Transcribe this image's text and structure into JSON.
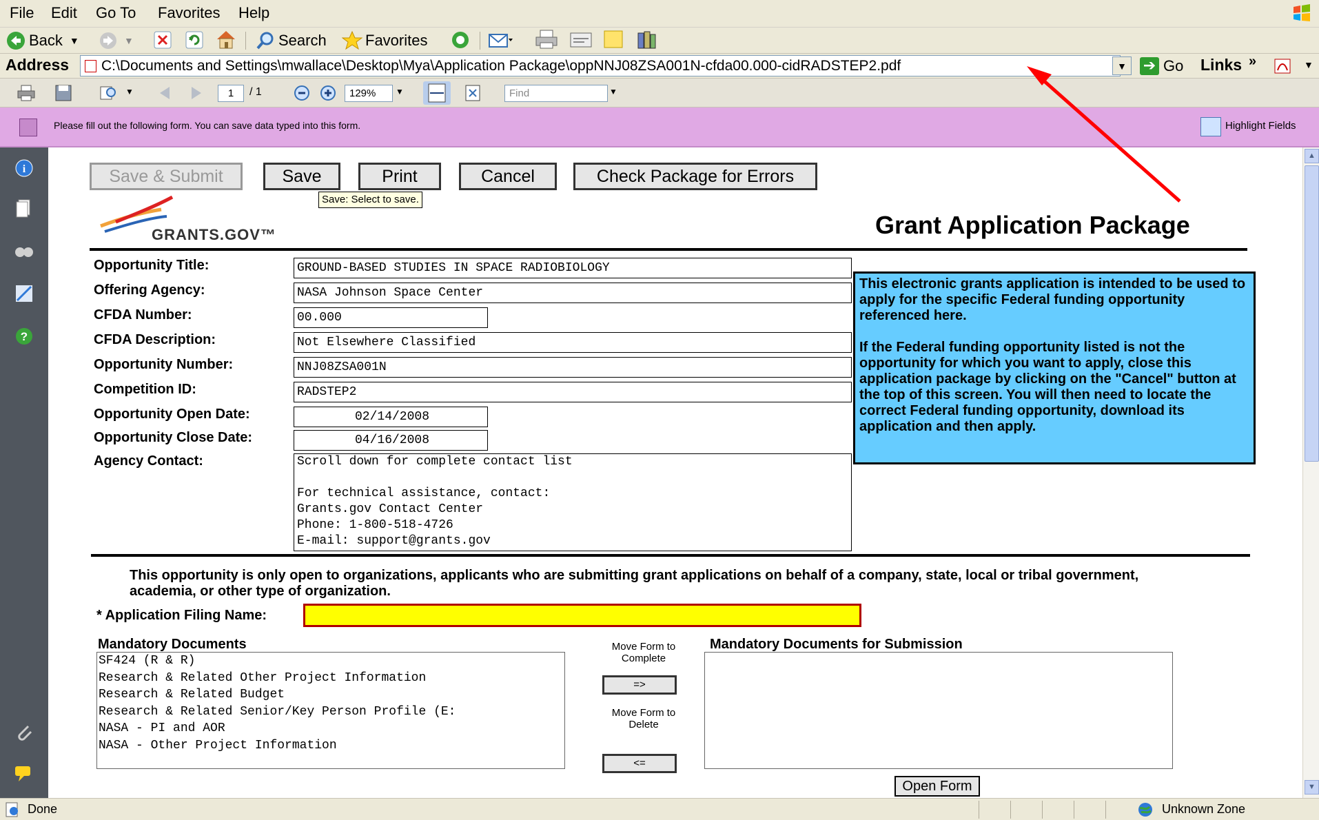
{
  "menu": [
    "File",
    "Edit",
    "Go To",
    "Favorites",
    "Help"
  ],
  "toolbar": {
    "back_label": "Back",
    "search_label": "Search",
    "favorites_label": "Favorites"
  },
  "address": {
    "label": "Address",
    "url": "C:\\Documents and Settings\\mwallace\\Desktop\\Mya\\Application Package\\oppNNJ08ZSA001N-cfda00.000-cidRADSTEP2.pdf",
    "go_label": "Go",
    "links_label": "Links",
    "links_chevron": "»"
  },
  "acrobat": {
    "page_current": "1",
    "page_total": "/ 1",
    "zoom": "129%",
    "find_placeholder": "Find"
  },
  "message_bar": {
    "text": "Please fill out the following form. You can save data typed into this form.",
    "highlight_label": "Highlight Fields"
  },
  "form_buttons": {
    "save_submit": "Save & Submit",
    "save": "Save",
    "print": "Print",
    "cancel": "Cancel",
    "check": "Check Package for Errors",
    "tooltip": "Save: Select to save."
  },
  "header": {
    "logo_text": "GRANTS.GOV™",
    "title": "Grant Application Package"
  },
  "fields": {
    "opportunity_title": {
      "label": "Opportunity Title:",
      "value": "GROUND-BASED STUDIES IN SPACE RADIOBIOLOGY"
    },
    "offering_agency": {
      "label": "Offering Agency:",
      "value": "NASA Johnson Space Center"
    },
    "cfda_number": {
      "label": "CFDA Number:",
      "value": "00.000"
    },
    "cfda_description": {
      "label": "CFDA Description:",
      "value": "Not Elsewhere Classified"
    },
    "opportunity_number": {
      "label": "Opportunity Number:",
      "value": "NNJ08ZSA001N"
    },
    "competition_id": {
      "label": "Competition ID:",
      "value": "RADSTEP2"
    },
    "open_date": {
      "label": "Opportunity Open Date:",
      "value": "02/14/2008"
    },
    "close_date": {
      "label": "Opportunity Close Date:",
      "value": "04/16/2008"
    },
    "agency_contact": {
      "label": "Agency Contact:",
      "lines": [
        "Scroll down for complete contact list",
        "",
        "For technical assistance, contact:",
        "Grants.gov Contact Center",
        "Phone: 1-800-518-4726",
        "E-mail: support@grants.gov"
      ]
    }
  },
  "info_box": {
    "para1": "This electronic grants application is intended to be used to apply for the specific Federal funding opportunity referenced here.",
    "para2": "If the Federal funding opportunity listed is not the opportunity for which you want to apply, close this application package by clicking on the \"Cancel\" button at the top of this screen. You will  then need to locate the correct Federal funding opportunity, download its application and then apply."
  },
  "notice": "This opportunity is only open to organizations, applicants who are submitting grant applications on behalf of a company, state, local or tribal government, academia, or other type of organization.",
  "filing": {
    "label": "* Application Filing Name:",
    "value": ""
  },
  "mandatory": {
    "heading": "Mandatory Documents",
    "items": [
      "SF424 (R & R)",
      "Research & Related Other Project Information",
      "Research & Related Budget",
      "Research & Related Senior/Key Person Profile (E:",
      "NASA - PI and AOR",
      "NASA - Other Project Information"
    ]
  },
  "move": {
    "to_complete_label": "Move Form to Complete",
    "to_complete_btn": "=>",
    "to_delete_label": "Move Form to Delete",
    "to_delete_btn": "<="
  },
  "submission": {
    "heading": "Mandatory Documents for Submission",
    "items": []
  },
  "open_form_label": "Open Form",
  "status": {
    "text": "Done",
    "zone": "Unknown Zone"
  },
  "colors": {
    "message_bar": "#e0a9e4",
    "info_box": "#66ccff",
    "filing_input": "#ffff00",
    "filing_border": "#b00000",
    "arrow": "#ff0000"
  }
}
